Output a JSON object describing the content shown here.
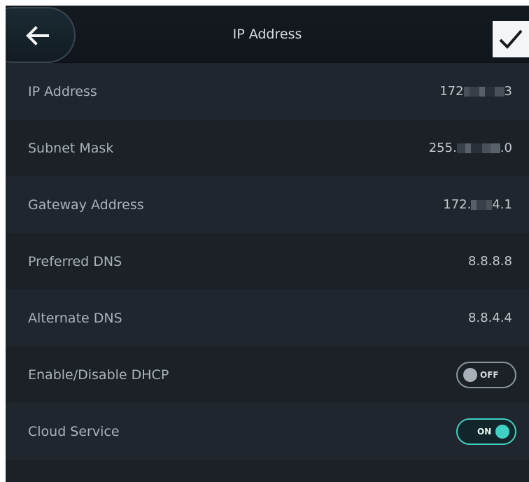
{
  "header": {
    "title": "IP Address",
    "back_icon": "back-arrow-icon",
    "confirm_icon": "checkmark-icon"
  },
  "fields": [
    {
      "label": "IP Address",
      "value_prefix": "172",
      "value_suffix": "3"
    },
    {
      "label": "Subnet Mask",
      "value_prefix": "255.",
      "value_suffix": ".0"
    },
    {
      "label": "Gateway Address",
      "value_prefix": "172.",
      "value_suffix": "4.1"
    },
    {
      "label": "Preferred DNS",
      "value": "8.8.8.8"
    },
    {
      "label": "Alternate DNS",
      "value": "8.8.4.4"
    }
  ],
  "toggles": [
    {
      "label": "Enable/Disable DHCP",
      "state_text": "OFF"
    },
    {
      "label": "Cloud Service",
      "state_text": "ON"
    }
  ],
  "colors": {
    "accent": "#3fd1c2",
    "background": "#1c2128",
    "header_background": "#10161b"
  }
}
